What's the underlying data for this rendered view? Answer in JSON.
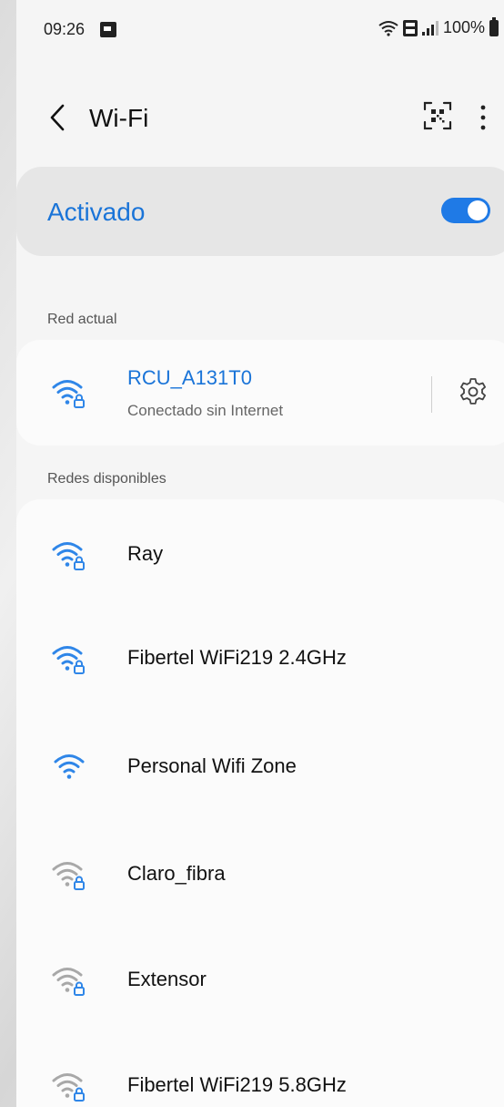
{
  "status_bar": {
    "time": "09:26",
    "battery": "100%"
  },
  "header": {
    "title": "Wi-Fi"
  },
  "wifi_toggle": {
    "label": "Activado",
    "on": true
  },
  "current_section": {
    "label": "Red actual",
    "network": {
      "name": "RCU_A131T0",
      "status": "Conectado sin Internet"
    }
  },
  "available_section": {
    "label": "Redes disponibles",
    "networks": [
      {
        "name": "Ray",
        "secured": true
      },
      {
        "name": "Fibertel WiFi219 2.4GHz",
        "secured": true
      },
      {
        "name": "Personal Wifi Zone",
        "secured": false
      },
      {
        "name": "Claro_fibra",
        "secured": true
      },
      {
        "name": "Extensor",
        "secured": true
      },
      {
        "name": "Fibertel WiFi219 5.8GHz",
        "secured": true
      }
    ]
  },
  "colors": {
    "accent": "#1a74d8",
    "toggle_on": "#1f7ae6",
    "wifi_strong": "#2f86e8",
    "wifi_weak": "#a8a8a8"
  }
}
